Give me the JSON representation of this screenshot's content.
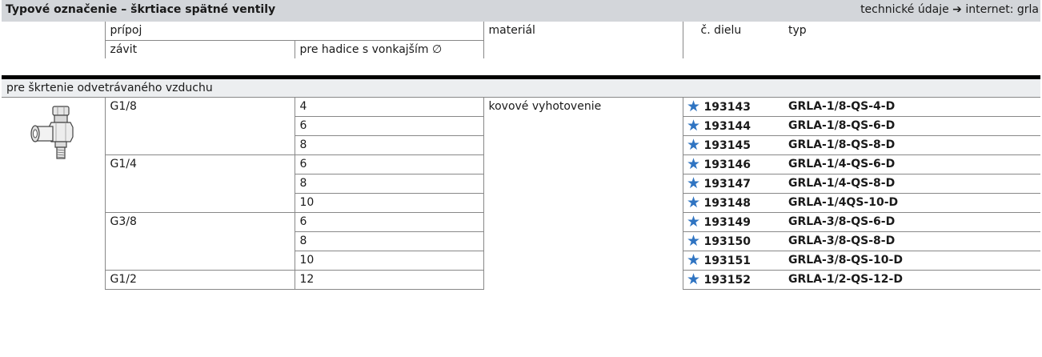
{
  "header": {
    "title": "Typové označenie – škrtiace spätné ventily",
    "info_text": "technické údaje",
    "info_link": "internet: grla"
  },
  "columns": {
    "connection": "prípoj",
    "thread": "závit",
    "hose": "pre hadice s vonkajším ∅",
    "material": "materiál",
    "part_no": "č. dielu",
    "type": "typ"
  },
  "section_label": "pre škrtenie odvetrávaného vzduchu",
  "material_value": "kovové vyhotovenie",
  "groups": [
    {
      "thread": "G1/8",
      "rows": [
        {
          "hose": "4",
          "part": "193143",
          "type": "GRLA-1/8-QS-4-D"
        },
        {
          "hose": "6",
          "part": "193144",
          "type": "GRLA-1/8-QS-6-D"
        },
        {
          "hose": "8",
          "part": "193145",
          "type": "GRLA-1/8-QS-8-D"
        }
      ]
    },
    {
      "thread": "G1/4",
      "rows": [
        {
          "hose": "6",
          "part": "193146",
          "type": "GRLA-1/4-QS-6-D"
        },
        {
          "hose": "8",
          "part": "193147",
          "type": "GRLA-1/4-QS-8-D"
        },
        {
          "hose": "10",
          "part": "193148",
          "type": "GRLA-1/4QS-10-D"
        }
      ]
    },
    {
      "thread": "G3/8",
      "rows": [
        {
          "hose": "6",
          "part": "193149",
          "type": "GRLA-3/8-QS-6-D"
        },
        {
          "hose": "8",
          "part": "193150",
          "type": "GRLA-3/8-QS-8-D"
        },
        {
          "hose": "10",
          "part": "193151",
          "type": "GRLA-3/8-QS-10-D"
        }
      ]
    },
    {
      "thread": "G1/2",
      "rows": [
        {
          "hose": "12",
          "part": "193152",
          "type": "GRLA-1/2-QS-12-D"
        }
      ]
    }
  ],
  "icons": {
    "star": "star-icon",
    "arrow": "arrow-right-icon",
    "product": "valve-fitting-image"
  },
  "colors": {
    "header_bg": "#d3d6da",
    "star": "#2f74c2",
    "section_bg": "#eceef0"
  }
}
